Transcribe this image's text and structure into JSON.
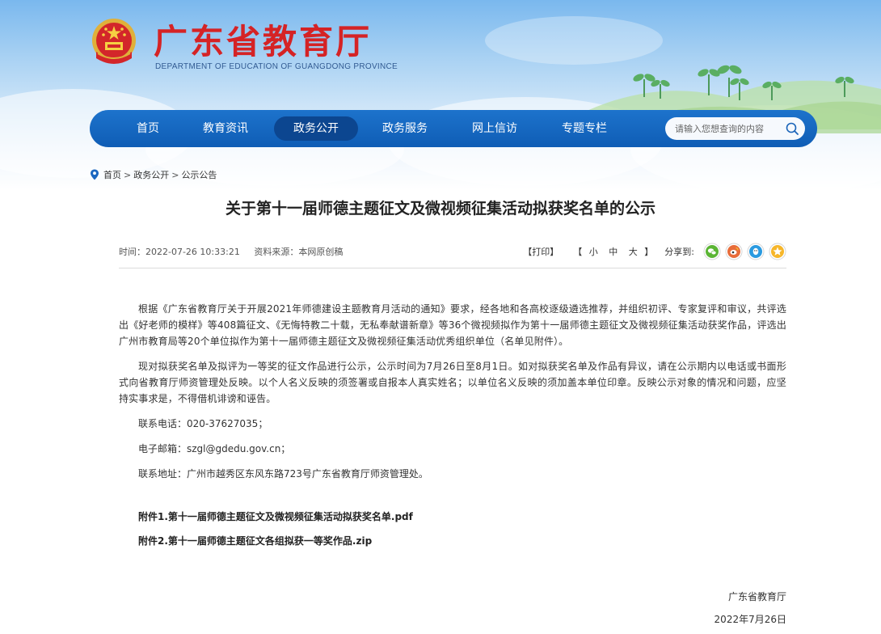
{
  "header": {
    "site_title": "广东省教育厅",
    "site_subtitle": "DEPARTMENT OF EDUCATION OF GUANGDONG PROVINCE",
    "colors": {
      "title_red": "#d52325",
      "nav_blue": "#1368c4",
      "nav_active": "#0c4690"
    }
  },
  "nav": {
    "items": [
      {
        "label": "首页"
      },
      {
        "label": "教育资讯"
      },
      {
        "label": "政务公开",
        "active": true
      },
      {
        "label": "政务服务"
      },
      {
        "label": "网上信访"
      },
      {
        "label": "专题专栏"
      }
    ],
    "search_placeholder": "请输入您想查询的内容"
  },
  "breadcrumb": [
    "首页",
    "政务公开",
    "公示公告"
  ],
  "article": {
    "title": "关于第十一届师德主题征文及微视频征集活动拟获奖名单的公示",
    "meta": {
      "time": "时间：2022-07-26 10:33:21",
      "source": "资料来源：本网原创稿"
    },
    "tools": {
      "print": "【打印】",
      "font_open": "【",
      "font_small": "小",
      "font_mid": "中",
      "font_large": "大",
      "font_close": "】",
      "share_label": "分享到:"
    },
    "paragraphs": [
      "根据《广东省教育厅关于开展2021年师德建设主题教育月活动的通知》要求，经各地和各高校逐级遴选推荐，并组织初评、专家复评和审议，共评选出《好老师的模样》等408篇征文、《无悔特教二十载，无私奉献谱新章》等36个微视频拟作为第十一届师德主题征文及微视频征集活动获奖作品，评选出广州市教育局等20个单位拟作为第十一届师德主题征文及微视频征集活动优秀组织单位（名单见附件）。",
      "现对拟获奖名单及拟评为一等奖的征文作品进行公示，公示时间为7月26日至8月1日。如对拟获奖名单及作品有异议，请在公示期内以电话或书面形式向省教育厅师资管理处反映。以个人名义反映的须签署或自报本人真实姓名；以单位名义反映的须加盖本单位印章。反映公示对象的情况和问题，应坚持实事求是，不得借机诽谤和诬告。"
    ],
    "contacts": [
      "联系电话：020-37627035；",
      "电子邮箱：szgl@gdedu.gov.cn；",
      "联系地址：广州市越秀区东风东路723号广东省教育厅师资管理处。"
    ],
    "attachments": [
      "附件1.第十一届师德主题征文及微视频征集活动拟获奖名单.pdf",
      "附件2.第十一届师德主题征文各组拟获一等奖作品.zip"
    ],
    "signature": "广东省教育厅",
    "date": "2022年7月26日"
  },
  "icons": {
    "share": [
      "wechat-icon",
      "weibo-icon",
      "qq-icon",
      "qzone-icon"
    ]
  }
}
